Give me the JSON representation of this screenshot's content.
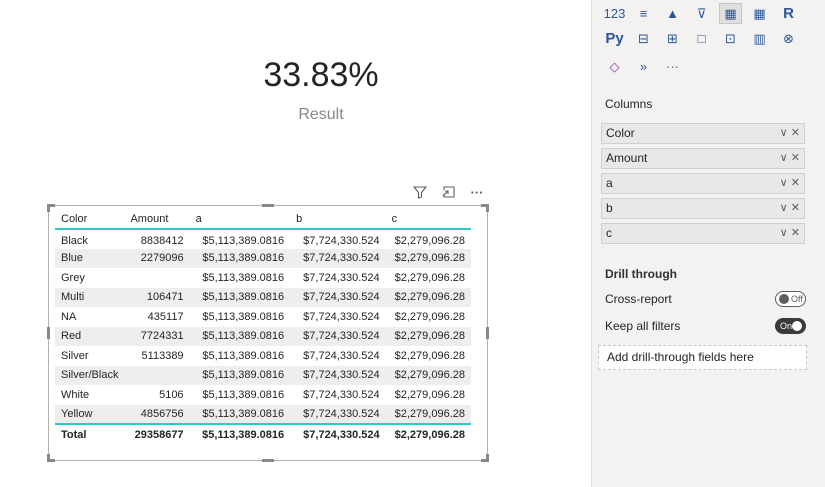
{
  "card": {
    "value": "33.83%",
    "label": "Result"
  },
  "table": {
    "columns": [
      "Color",
      "Amount",
      "a",
      "b",
      "c"
    ],
    "rows": [
      [
        "Black",
        "8838412",
        "$5,113,389.0816",
        "$7,724,330.524",
        "$2,279,096.28"
      ],
      [
        "Blue",
        "2279096",
        "$5,113,389.0816",
        "$7,724,330.524",
        "$2,279,096.28"
      ],
      [
        "Grey",
        "",
        "$5,113,389.0816",
        "$7,724,330.524",
        "$2,279,096.28"
      ],
      [
        "Multi",
        "106471",
        "$5,113,389.0816",
        "$7,724,330.524",
        "$2,279,096.28"
      ],
      [
        "NA",
        "435117",
        "$5,113,389.0816",
        "$7,724,330.524",
        "$2,279,096.28"
      ],
      [
        "Red",
        "7724331",
        "$5,113,389.0816",
        "$7,724,330.524",
        "$2,279,096.28"
      ],
      [
        "Silver",
        "5113389",
        "$5,113,389.0816",
        "$7,724,330.524",
        "$2,279,096.28"
      ],
      [
        "Silver/Black",
        "",
        "$5,113,389.0816",
        "$7,724,330.524",
        "$2,279,096.28"
      ],
      [
        "White",
        "5106",
        "$5,113,389.0816",
        "$7,724,330.524",
        "$2,279,096.28"
      ],
      [
        "Yellow",
        "4856756",
        "$5,113,389.0816",
        "$7,724,330.524",
        "$2,279,096.28"
      ]
    ],
    "total": [
      "Total",
      "29358677",
      "$5,113,389.0816",
      "$7,724,330.524",
      "$2,279,096.28"
    ],
    "accent_color": "#32c7c0"
  },
  "pane": {
    "viz_rows": [
      [
        "123",
        "≡",
        "▲",
        "⊽",
        "▦",
        "▦",
        "R"
      ],
      [
        "Py",
        "⊟",
        "⊞",
        "□",
        "⊡",
        "▥",
        "⊗"
      ],
      [
        "◇",
        "»",
        "···"
      ]
    ],
    "columns_label": "Columns",
    "fields": [
      "Color",
      "Amount",
      "a",
      "b",
      "c"
    ],
    "field_controls": "∨ ✕",
    "drill_through_label": "Drill through",
    "cross_report_label": "Cross-report",
    "cross_report_state": "Off",
    "keep_filters_label": "Keep all filters",
    "keep_filters_state": "On",
    "drop_zone_text": "Add drill-through fields here"
  },
  "visual_header": {
    "icons": [
      "filter-icon",
      "focus-mode-icon",
      "more-options-icon"
    ],
    "more_text": "···"
  }
}
